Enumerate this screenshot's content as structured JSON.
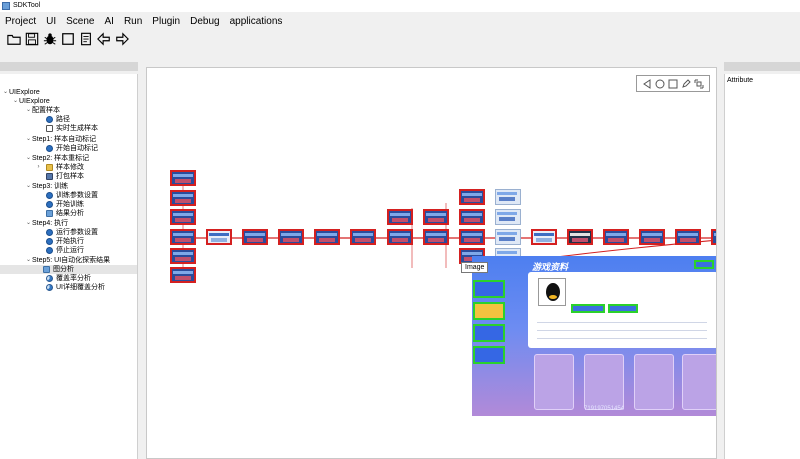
{
  "window": {
    "title": "SDKTool"
  },
  "menu": [
    "Project",
    "UI",
    "Scene",
    "AI",
    "Run",
    "Plugin",
    "Debug",
    "applications"
  ],
  "toolbar": {
    "icons": [
      "open-folder-icon",
      "save-icon",
      "bug-icon",
      "stop-square-icon",
      "document-icon",
      "back-arrow-icon",
      "forward-arrow-icon"
    ]
  },
  "tree": {
    "root": "UIExplore",
    "child": "UIExplore",
    "config": {
      "label": "配置样本",
      "items": [
        "路径",
        "实时生成样本"
      ]
    },
    "step1": {
      "label": "Step1: 样本自动标记",
      "items": [
        "开始自动标记"
      ]
    },
    "step2": {
      "label": "Step2: 样本重标记",
      "items": [
        "样本修改",
        "打包样本"
      ]
    },
    "step3": {
      "label": "Step3: 训练",
      "items": [
        "训练参数设置",
        "开始训练",
        "结果分析"
      ]
    },
    "step4": {
      "label": "Step4: 执行",
      "items": [
        "运行参数设置",
        "开始执行",
        "停止运行"
      ]
    },
    "step5": {
      "label": "Step5: UI自动化探索结果",
      "items": [
        "图分析",
        "覆盖率分析",
        "UI详细覆盖分析"
      ]
    }
  },
  "tooltip": "Image",
  "preview": {
    "title": "游戏资料",
    "id_text": "719197051454"
  },
  "attribute_panel": {
    "title": "Attribute"
  },
  "colors": {
    "edge": "#d42020",
    "highlight": "#2bd12b",
    "selection": "#e5e5e5"
  }
}
